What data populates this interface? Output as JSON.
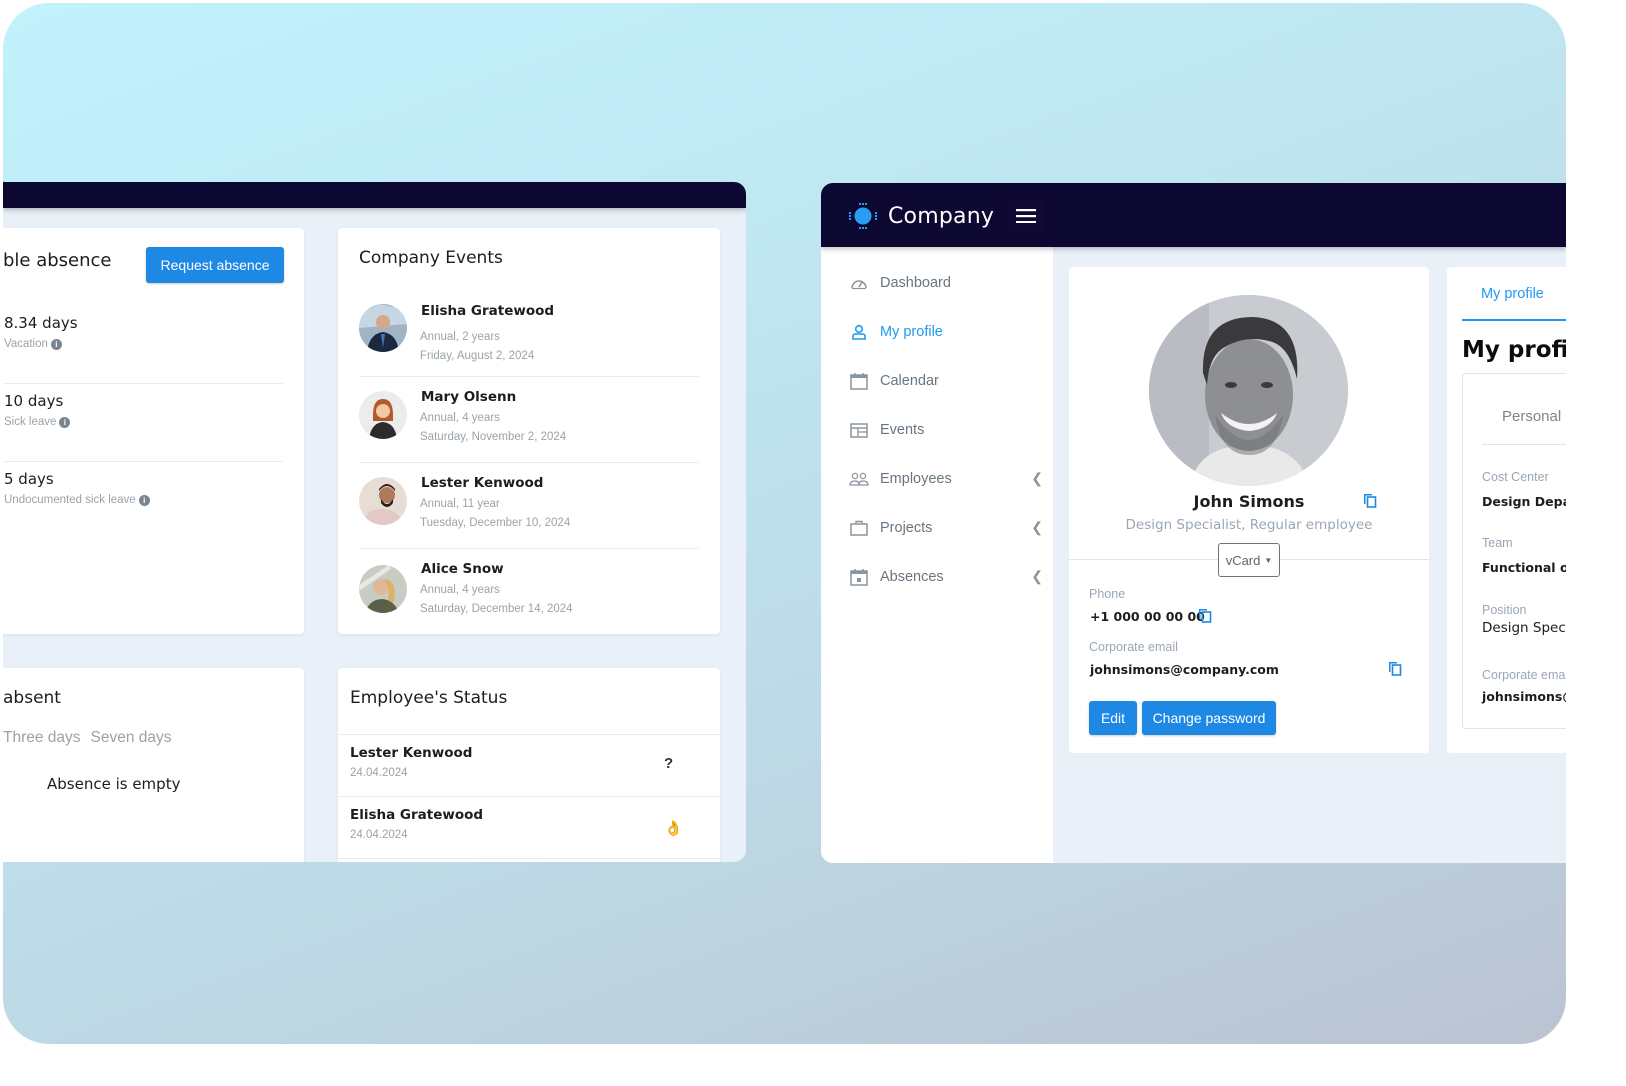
{
  "left_panel": {
    "absence_card": {
      "title_partial": "ble absence",
      "request_button": "Request absence",
      "balances": [
        {
          "days": "8.34 days",
          "type": "Vacation",
          "info_icon": "info-icon"
        },
        {
          "days": "10 days",
          "type": "Sick leave",
          "info_icon": "info-icon"
        },
        {
          "days": "5 days",
          "type": "Undocumented sick leave",
          "info_icon": "info-icon"
        }
      ]
    },
    "absent_card": {
      "title_partial": "absent",
      "tabs": [
        "Three days",
        "Seven days"
      ],
      "empty_message": "Absence is empty"
    },
    "events_card": {
      "title": "Company Events",
      "events": [
        {
          "name": "Elisha Gratewood",
          "type": "Annual, 2 years",
          "date": "Friday, August 2, 2024"
        },
        {
          "name": "Mary Olsenn",
          "type": "Annual, 4 years",
          "date": "Saturday, November 2, 2024"
        },
        {
          "name": "Lester Kenwood",
          "type": "Annual, 11 year",
          "date": "Tuesday, December 10, 2024"
        },
        {
          "name": "Alice Snow",
          "type": "Annual, 4 years",
          "date": "Saturday, December 14, 2024"
        }
      ]
    },
    "status_card": {
      "title": "Employee's Status",
      "rows": [
        {
          "name": "Lester Kenwood",
          "date": "24.04.2024",
          "status": "?"
        },
        {
          "name": "Elisha Gratewood",
          "date": "24.04.2024",
          "status": "👌"
        }
      ]
    }
  },
  "right_panel": {
    "brand": {
      "name": "Company",
      "menu_icon": "hamburger-icon"
    },
    "sidebar": {
      "items": [
        {
          "label": "Dashboard",
          "icon": "gauge-icon",
          "active": false
        },
        {
          "label": "My profile",
          "icon": "user-icon",
          "active": true
        },
        {
          "label": "Calendar",
          "icon": "calendar-icon",
          "active": false
        },
        {
          "label": "Events",
          "icon": "events-icon",
          "active": false
        },
        {
          "label": "Employees",
          "icon": "users-icon",
          "active": false,
          "expandable": true
        },
        {
          "label": "Projects",
          "icon": "briefcase-icon",
          "active": false,
          "expandable": true
        },
        {
          "label": "Absences",
          "icon": "calendar-day-icon",
          "active": false,
          "expandable": true
        }
      ]
    },
    "profile_card": {
      "name": "John Simons",
      "role": "Design Specialist, Regular employee",
      "vcard_label": "vCard",
      "phone_label": "Phone",
      "phone": "+1 000 00 00 00",
      "email_label": "Corporate email",
      "email": "johnsimons@company.com",
      "edit_button": "Edit",
      "change_password_button": "Change password"
    },
    "my_profile_card": {
      "tab": "My profile",
      "heading": "My profile",
      "subtab": "Personal",
      "fields": [
        {
          "label": "Cost Center",
          "value": "Design Depart"
        },
        {
          "label": "Team",
          "value": "Functional off"
        },
        {
          "label": "Position",
          "value": "Design Speci"
        },
        {
          "label": "Corporate ema",
          "value": "johnsimons@"
        }
      ]
    }
  },
  "colors": {
    "navbar": "#0d0832",
    "accent": "#1e88e5",
    "active_link": "#1e9bf0",
    "page_bg": "#e9f0f7"
  }
}
